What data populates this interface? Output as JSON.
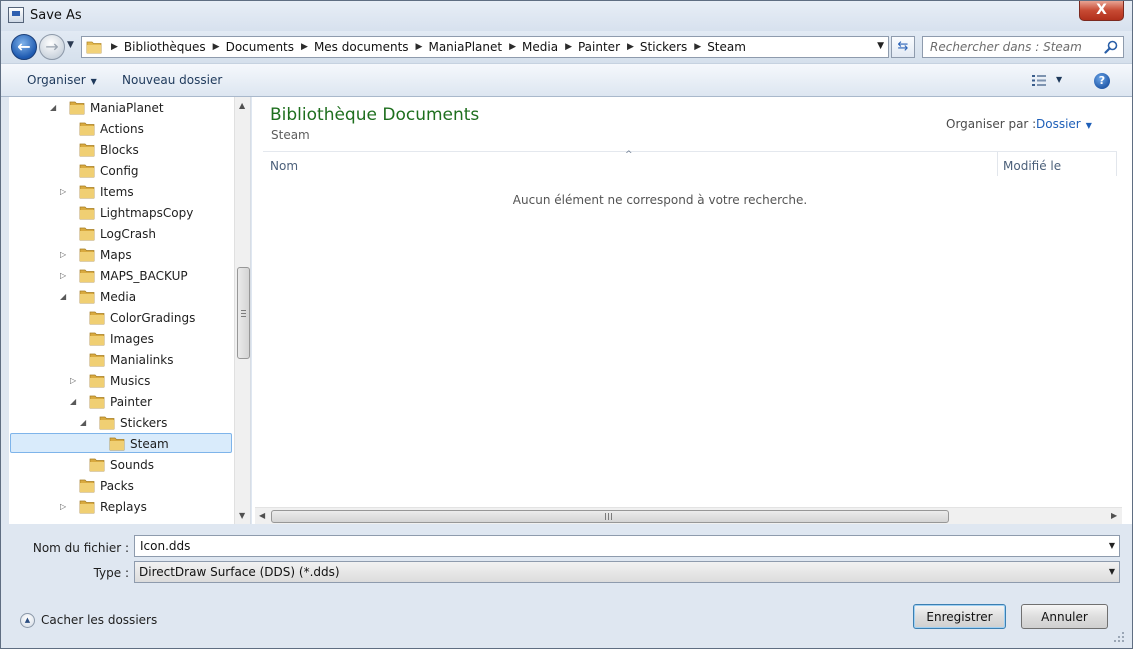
{
  "window": {
    "title": "Save As",
    "close_label": "X"
  },
  "address": {
    "crumbs": [
      "Bibliothèques",
      "Documents",
      "Mes documents",
      "ManiaPlanet",
      "Media",
      "Painter",
      "Stickers",
      "Steam"
    ]
  },
  "search": {
    "placeholder": "Rechercher dans : Steam"
  },
  "toolbar": {
    "organiser_label": "Organiser",
    "new_folder_label": "Nouveau dossier",
    "help_label": "?"
  },
  "tree": {
    "items": [
      {
        "label": "ManiaPlanet",
        "level": 0,
        "expander": "open"
      },
      {
        "label": "Actions",
        "level": 1,
        "expander": "none"
      },
      {
        "label": "Blocks",
        "level": 1,
        "expander": "none"
      },
      {
        "label": "Config",
        "level": 1,
        "expander": "none"
      },
      {
        "label": "Items",
        "level": 1,
        "expander": "closed"
      },
      {
        "label": "LightmapsCopy",
        "level": 1,
        "expander": "none"
      },
      {
        "label": "LogCrash",
        "level": 1,
        "expander": "none"
      },
      {
        "label": "Maps",
        "level": 1,
        "expander": "closed"
      },
      {
        "label": "MAPS_BACKUP",
        "level": 1,
        "expander": "closed"
      },
      {
        "label": "Media",
        "level": 1,
        "expander": "open"
      },
      {
        "label": "ColorGradings",
        "level": 2,
        "expander": "none"
      },
      {
        "label": "Images",
        "level": 2,
        "expander": "none"
      },
      {
        "label": "Manialinks",
        "level": 2,
        "expander": "none"
      },
      {
        "label": "Musics",
        "level": 2,
        "expander": "closed"
      },
      {
        "label": "Painter",
        "level": 2,
        "expander": "open"
      },
      {
        "label": "Stickers",
        "level": 3,
        "expander": "open"
      },
      {
        "label": "Steam",
        "level": 4,
        "expander": "none",
        "selected": true
      },
      {
        "label": "Sounds",
        "level": 2,
        "expander": "none"
      },
      {
        "label": "Packs",
        "level": 1,
        "expander": "none"
      },
      {
        "label": "Replays",
        "level": 1,
        "expander": "closed"
      }
    ]
  },
  "content": {
    "library_title": "Bibliothèque Documents",
    "library_subtitle": "Steam",
    "arrange_label": "Organiser par :",
    "arrange_value": "Dossier",
    "column_name": "Nom",
    "column_modified": "Modifié le",
    "empty_message": "Aucun élément ne correspond à votre recherche."
  },
  "form": {
    "filename_label": "Nom du fichier :",
    "filename_value": "Icon.dds",
    "type_label": "Type :",
    "type_value": "DirectDraw Surface (DDS) (*.dds)",
    "hide_folders_label": "Cacher les dossiers",
    "save_label": "Enregistrer",
    "cancel_label": "Annuler"
  },
  "colors": {
    "library_title": "#1e6f1e",
    "link_blue": "#1e5fb8",
    "selection": "#d9ebfb",
    "folder": "#e8c463"
  },
  "icons": {
    "folder": "folder-icon",
    "search": "search-icon",
    "back": "back-arrow-icon",
    "forward": "forward-arrow-icon",
    "refresh": "refresh-icon",
    "help": "help-icon",
    "view": "view-list-icon"
  }
}
